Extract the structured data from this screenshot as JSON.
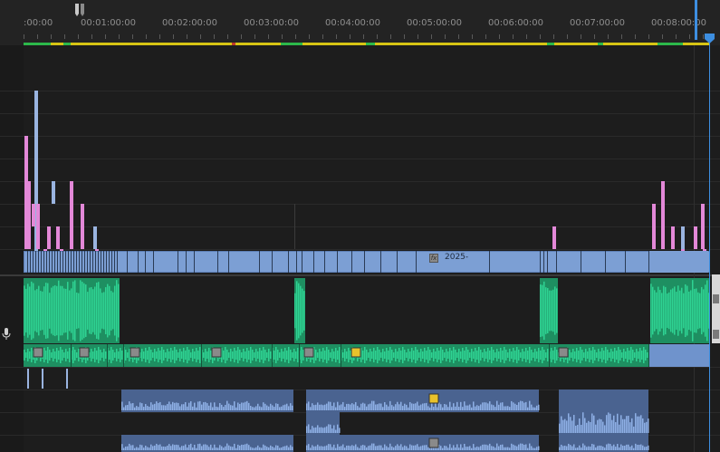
{
  "ruler": {
    "timecodes": [
      ":00:00",
      "00:01:00:00",
      "00:02:00:00",
      "00:03:00:00",
      "00:04:00:00",
      "00:05:00:00",
      "00:06:00:00",
      "00:07:00:00",
      "00:08:00:00"
    ]
  },
  "tracks": {
    "video_label": "2025-",
    "fx_label": "fx"
  },
  "colors": {
    "video_clip": "#7c9fd4",
    "video_clip_dark": "#5d7fb5",
    "audio_clip": "#2fd393",
    "audio_clip_dark": "#1e8f61",
    "marker_pink": "#e388d8",
    "playhead": "#3d8ee0",
    "work_area": "#d7c414",
    "fx_badge_yellow": "#e8c22b",
    "fx_badge_gray": "#8a8a8a"
  },
  "icons": [
    "playhead-icon",
    "in-out-marker-icon",
    "microphone-icon",
    "fx-badge-icon"
  ]
}
